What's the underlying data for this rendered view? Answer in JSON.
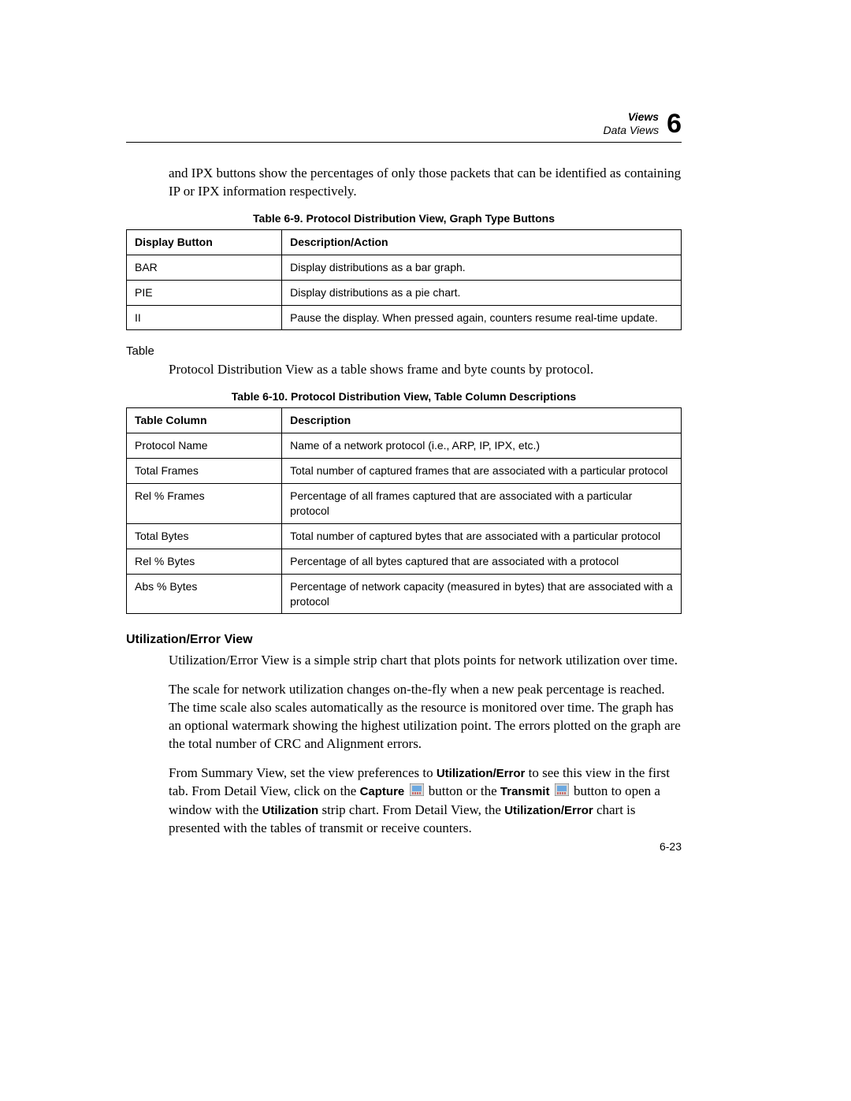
{
  "header": {
    "section": "Views",
    "subsection": "Data Views",
    "chapter": "6"
  },
  "intro_para": "and IPX buttons show the percentages of only those packets that can be identified as containing IP or IPX information respectively.",
  "table69": {
    "caption": "Table 6-9. Protocol Distribution View, Graph Type Buttons",
    "headers": [
      "Display Button",
      "Description/Action"
    ],
    "rows": [
      {
        "c1": "BAR",
        "c2": "Display distributions as a bar graph."
      },
      {
        "c1": "PIE",
        "c2": "Display distributions as a pie chart."
      },
      {
        "c1": "II",
        "c2": "Pause the display. When pressed again, counters resume real-time update."
      }
    ]
  },
  "table_side_heading": "Table",
  "table_para": "Protocol Distribution View as a table shows frame and byte counts by protocol.",
  "table610": {
    "caption": "Table 6-10. Protocol Distribution View, Table Column Descriptions",
    "headers": [
      "Table Column",
      "Description"
    ],
    "rows": [
      {
        "c1": "Protocol Name",
        "c2": "Name of a network protocol (i.e., ARP, IP, IPX, etc.)"
      },
      {
        "c1": "Total Frames",
        "c2": "Total number of captured frames that are associated with a particular protocol"
      },
      {
        "c1": "Rel % Frames",
        "c2": "Percentage of all frames captured that are associated with a particular protocol"
      },
      {
        "c1": "Total Bytes",
        "c2": "Total number of captured bytes that are associated with a particular protocol"
      },
      {
        "c1": "Rel % Bytes",
        "c2": "Percentage of all bytes captured that are associated with a protocol"
      },
      {
        "c1": "Abs % Bytes",
        "c2": "Percentage of network capacity (measured in bytes) that are associated with a protocol"
      }
    ]
  },
  "util_heading": "Utilization/Error View",
  "util_p1": "Utilization/Error View is a simple strip chart that plots points for network utilization over time.",
  "util_p2": "The scale for network utilization changes on-the-fly when a new peak percentage is reached. The time scale also scales automatically as the resource is monitored over time. The graph has an optional watermark showing the highest utilization point. The errors plotted on the graph are the total number of CRC and Alignment errors.",
  "util_p3": {
    "t1": "From Summary View, set the view preferences to ",
    "b1": "Utilization/Error",
    "t2": " to see this view in the first tab. From Detail View, click on the ",
    "b2": "Capture",
    "t3": " button or the ",
    "b3": "Transmit",
    "t4": " button to open a window with the ",
    "b4": "Utilization",
    "t5": " strip chart. From Detail View, the ",
    "b5": "Utilization/Error",
    "t6": " chart is presented with the tables of transmit or receive counters."
  },
  "page_num": "6-23"
}
